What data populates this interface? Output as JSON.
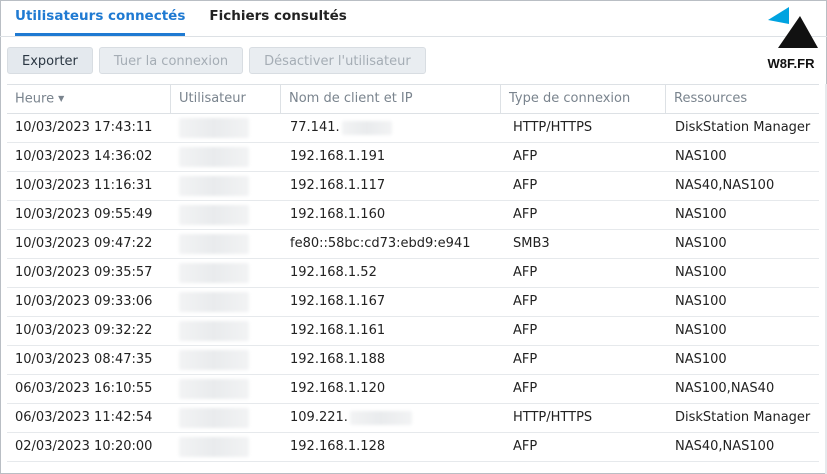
{
  "tabs": {
    "connected_users": "Utilisateurs connectés",
    "viewed_files": "Fichiers consultés"
  },
  "logo": {
    "text": "W8F.FR"
  },
  "toolbar": {
    "export": "Exporter",
    "kill_connection": "Tuer la connexion",
    "disable_user": "Désactiver l'utilisateur"
  },
  "table": {
    "headers": {
      "time": "Heure",
      "user": "Utilisateur",
      "client": "Nom de client et IP",
      "connection_type": "Type de connexion",
      "resources": "Ressources"
    },
    "rows": [
      {
        "time": "10/03/2023 17:43:11",
        "client": "77.141.",
        "type": "HTTP/HTTPS",
        "resources": "DiskStation Manager"
      },
      {
        "time": "10/03/2023 14:36:02",
        "client": "192.168.1.191",
        "type": "AFP",
        "resources": "NAS100"
      },
      {
        "time": "10/03/2023 11:16:31",
        "client": "192.168.1.117",
        "type": "AFP",
        "resources": "NAS40,NAS100"
      },
      {
        "time": "10/03/2023 09:55:49",
        "client": "192.168.1.160",
        "type": "AFP",
        "resources": "NAS100"
      },
      {
        "time": "10/03/2023 09:47:22",
        "client": "fe80::58bc:cd73:ebd9:e941",
        "type": "SMB3",
        "resources": "NAS100"
      },
      {
        "time": "10/03/2023 09:35:57",
        "client": "192.168.1.52",
        "type": "AFP",
        "resources": "NAS100"
      },
      {
        "time": "10/03/2023 09:33:06",
        "client": "192.168.1.167",
        "type": "AFP",
        "resources": "NAS100"
      },
      {
        "time": "10/03/2023 09:32:22",
        "client": "192.168.1.161",
        "type": "AFP",
        "resources": "NAS100"
      },
      {
        "time": "10/03/2023 08:47:35",
        "client": "192.168.1.188",
        "type": "AFP",
        "resources": "NAS100"
      },
      {
        "time": "06/03/2023 16:10:55",
        "client": "192.168.1.120",
        "type": "AFP",
        "resources": "NAS100,NAS40"
      },
      {
        "time": "06/03/2023 11:42:54",
        "client": "109.221.",
        "type": "HTTP/HTTPS",
        "resources": "DiskStation Manager"
      },
      {
        "time": "02/03/2023 10:20:00",
        "client": "192.168.1.128",
        "type": "AFP",
        "resources": "NAS40,NAS100"
      }
    ]
  },
  "colors": {
    "accent": "#1f7ad2"
  }
}
